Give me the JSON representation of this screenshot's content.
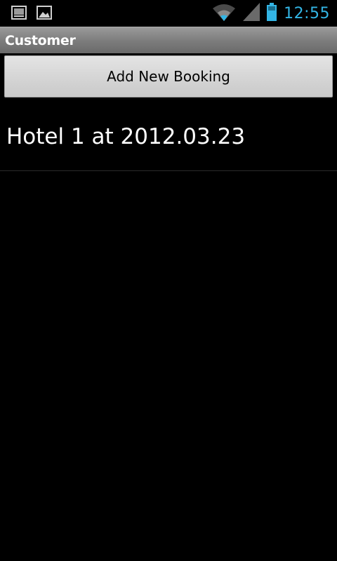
{
  "status_bar": {
    "notification_icons": [
      "terminal-icon",
      "image-icon"
    ],
    "icons": [
      "wifi-icon",
      "signal-icon",
      "battery-icon"
    ],
    "clock": "12:55",
    "accent": "#33b5e5"
  },
  "title_bar": {
    "title": "Customer"
  },
  "actions": {
    "add_booking_label": "Add New Booking"
  },
  "bookings": [
    {
      "label": "Hotel 1 at 2012.03.23"
    }
  ]
}
